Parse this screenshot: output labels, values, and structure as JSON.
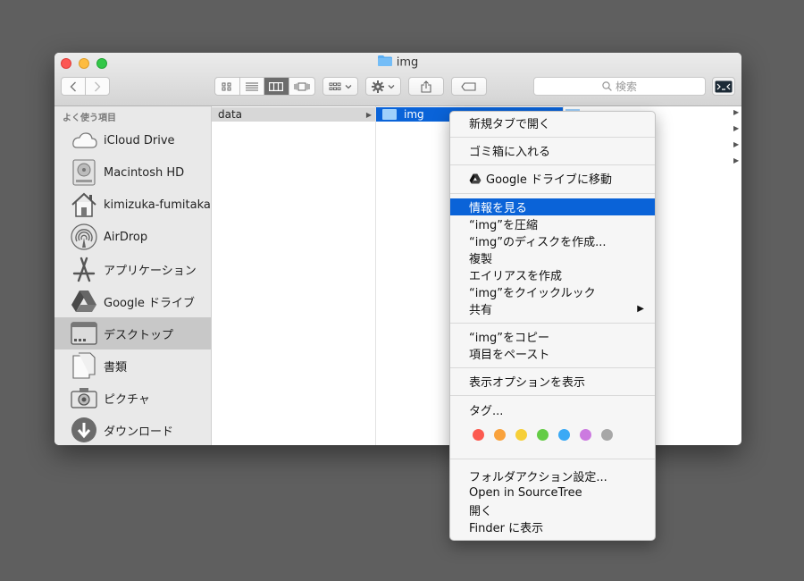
{
  "window": {
    "title": "img",
    "search_placeholder": "検索"
  },
  "sidebar": {
    "header": "よく使う項目",
    "items": [
      {
        "label": "iCloud Drive",
        "icon": "cloud-icon"
      },
      {
        "label": "Macintosh HD",
        "icon": "hard-drive-icon"
      },
      {
        "label": "kimizuka-fumitaka",
        "icon": "home-icon"
      },
      {
        "label": "AirDrop",
        "icon": "airdrop-icon"
      },
      {
        "label": "アプリケーション",
        "icon": "applications-icon"
      },
      {
        "label": "Google ドライブ",
        "icon": "google-drive-icon"
      },
      {
        "label": "デスクトップ",
        "icon": "desktop-icon",
        "selected": true
      },
      {
        "label": "書類",
        "icon": "documents-icon"
      },
      {
        "label": "ピクチャ",
        "icon": "camera-icon"
      },
      {
        "label": "ダウンロード",
        "icon": "download-icon"
      }
    ]
  },
  "columns": {
    "col1": [
      {
        "label": "data"
      }
    ],
    "col2": [
      {
        "label": "img"
      }
    ]
  },
  "context_menu": {
    "items": {
      "open_new_tab": "新規タブで開く",
      "trash": "ゴミ箱に入れる",
      "google_move": "Google ドライブに移動",
      "get_info": "情報を見る",
      "compress": "“img”を圧縮",
      "make_disk": "“img”のディスクを作成...",
      "duplicate": "複製",
      "make_alias": "エイリアスを作成",
      "quick_look": "“img”をクイックルック",
      "share": "共有",
      "copy": "“img”をコピー",
      "paste": "項目をペースト",
      "view_options": "表示オプションを表示",
      "tags": "タグ...",
      "folder_action": "フォルダアクション設定...",
      "sourcetree": "Open in SourceTree",
      "open": "開く",
      "show_in_finder": "Finder に表示"
    },
    "tag_colors": [
      "#fc5a50",
      "#f9a23c",
      "#f6cf38",
      "#64cc46",
      "#3aa9f5",
      "#cc7ae0",
      "#a7a7a7"
    ]
  }
}
